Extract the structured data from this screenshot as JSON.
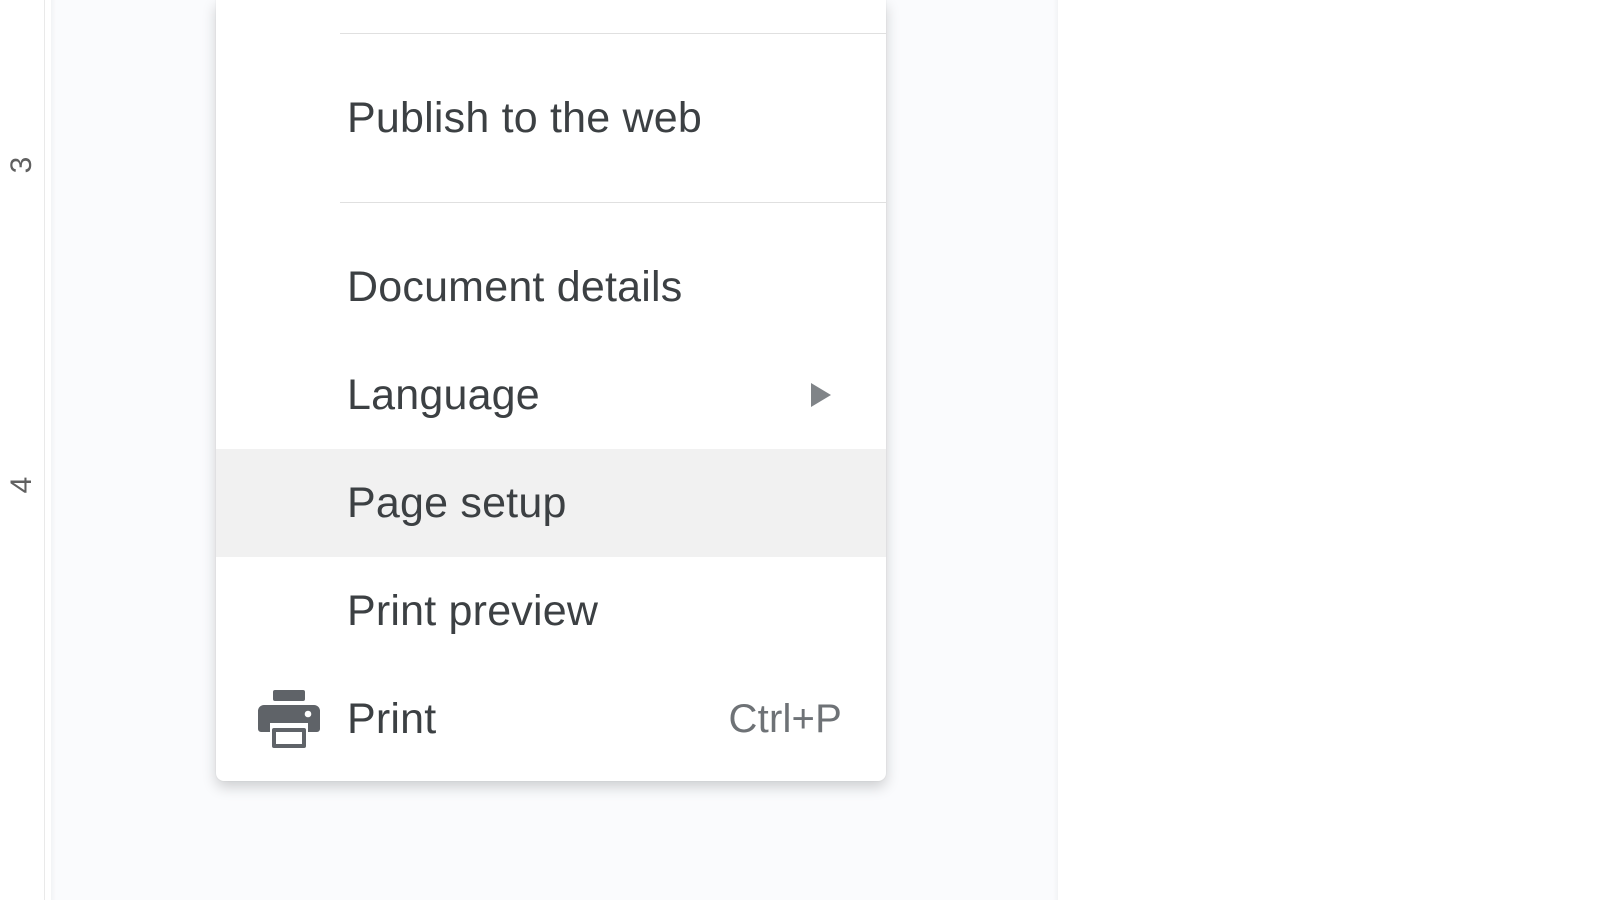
{
  "ruler": {
    "labels": [
      "3",
      "4"
    ]
  },
  "menu": {
    "items": [
      {
        "id": "publish",
        "label": "Publish to the web",
        "has_submenu": false,
        "icon": null,
        "shortcut": null,
        "highlighted": false
      },
      {
        "id": "doc-details",
        "label": "Document details",
        "has_submenu": false,
        "icon": null,
        "shortcut": null,
        "highlighted": false
      },
      {
        "id": "language",
        "label": "Language",
        "has_submenu": true,
        "icon": null,
        "shortcut": null,
        "highlighted": false
      },
      {
        "id": "page-setup",
        "label": "Page setup",
        "has_submenu": false,
        "icon": null,
        "shortcut": null,
        "highlighted": true
      },
      {
        "id": "print-preview",
        "label": "Print preview",
        "has_submenu": false,
        "icon": null,
        "shortcut": null,
        "highlighted": false
      },
      {
        "id": "print",
        "label": "Print",
        "has_submenu": false,
        "icon": "print",
        "shortcut": "Ctrl+P",
        "highlighted": false
      }
    ]
  }
}
